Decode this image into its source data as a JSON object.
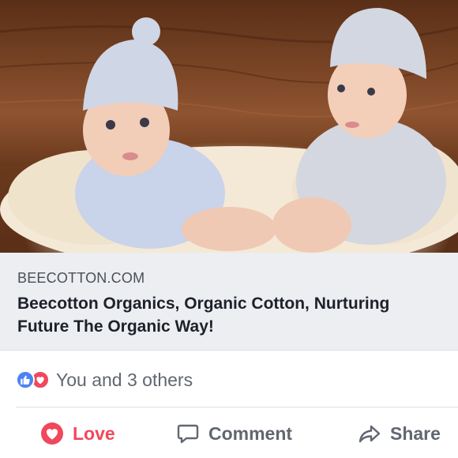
{
  "post_image": {
    "alt_icon": "baby-photo"
  },
  "link_preview": {
    "domain": "BEECOTTON.COM",
    "headline": "Beecotton Organics, Organic Cotton, Nurturing Future The Organic Way!"
  },
  "reactions": {
    "icons": [
      "like-icon",
      "love-icon"
    ],
    "text": "You and 3 others"
  },
  "actions": {
    "love_label": "Love",
    "comment_label": "Comment",
    "share_label": "Share"
  },
  "colors": {
    "love_red": "#f0485c",
    "like_blue": "#4a84f2",
    "text_gray": "#616770",
    "link_bg": "#eceef1"
  }
}
